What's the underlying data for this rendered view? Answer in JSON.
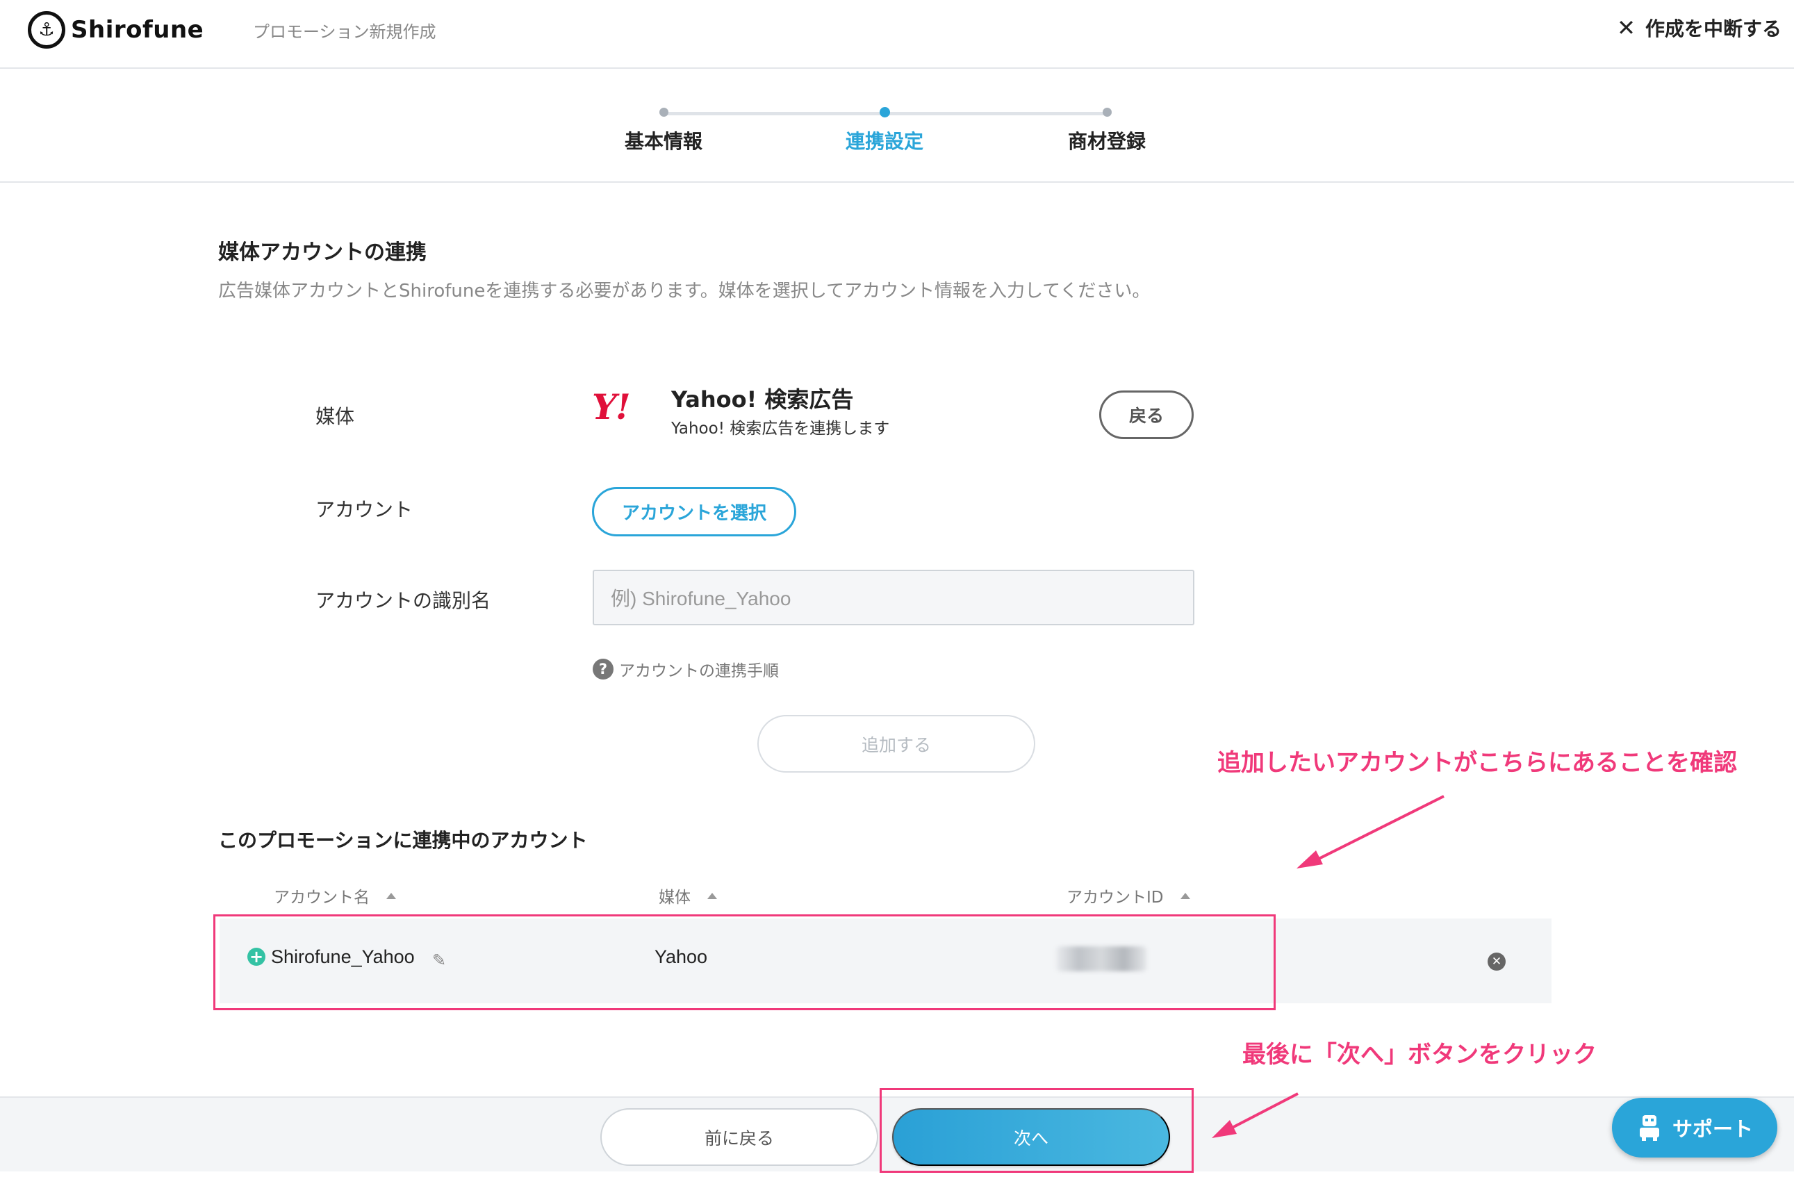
{
  "header": {
    "logo_text": "Shirofune",
    "subtitle": "プロモーション新規作成",
    "abort_label": "作成を中断する"
  },
  "stepper": {
    "steps": [
      {
        "label": "基本情報",
        "active": false
      },
      {
        "label": "連携設定",
        "active": true
      },
      {
        "label": "商材登録",
        "active": false
      }
    ]
  },
  "section": {
    "title": "媒体アカウントの連携",
    "description": "広告媒体アカウントとShirofuneを連携する必要があります。媒体を選択してアカウント情報を入力してください。"
  },
  "form": {
    "media_label": "媒体",
    "media_logo": "Y!",
    "media_name": "Yahoo! 検索広告",
    "media_sub": "Yahoo! 検索広告を連携します",
    "back_button": "戻る",
    "account_label": "アカウント",
    "select_account_button": "アカウントを選択",
    "account_name_label": "アカウントの識別名",
    "account_name_placeholder": "例) Shirofune_Yahoo",
    "help_text": "アカウントの連携手順",
    "add_button": "追加する"
  },
  "annotations": {
    "note1": "追加したいアカウントがこちらにあることを確認",
    "note2": "最後に「次へ」ボタンをクリック"
  },
  "linked": {
    "title": "このプロモーションに連携中のアカウント",
    "columns": [
      "アカウント名",
      "媒体",
      "アカウントID"
    ],
    "rows": [
      {
        "name": "Shirofune_Yahoo",
        "media": "Yahoo"
      }
    ]
  },
  "footer": {
    "prev_button": "前に戻る",
    "next_button": "次へ"
  },
  "support": {
    "label": "サポート"
  },
  "colors": {
    "accent": "#2aa5d9",
    "annotation": "#f0397a",
    "yahoo_red": "#e0103a",
    "plus_green": "#33c2a4"
  }
}
